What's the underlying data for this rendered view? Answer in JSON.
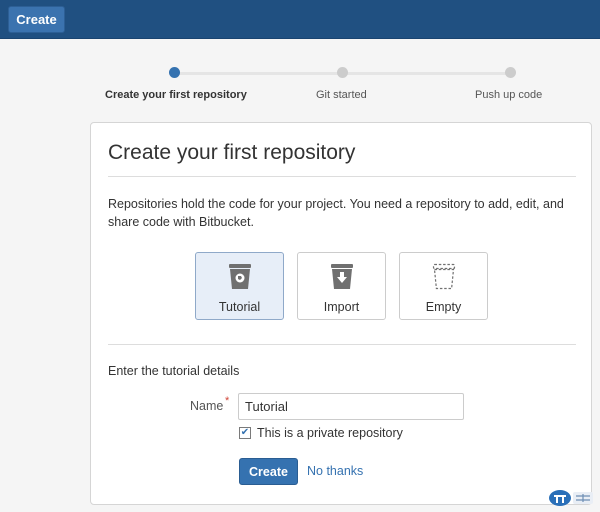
{
  "topbar": {
    "create_label": "Create"
  },
  "progress": {
    "steps": [
      {
        "label": "Create your first repository"
      },
      {
        "label": "Git started"
      },
      {
        "label": "Push up code"
      }
    ]
  },
  "card": {
    "title": "Create your first repository",
    "intro": "Repositories hold the code for your project. You need a repository to add, edit, and share code with Bitbucket.",
    "options": [
      {
        "label": "Tutorial",
        "icon": "bucket-tutorial-icon"
      },
      {
        "label": "Import",
        "icon": "bucket-import-icon"
      },
      {
        "label": "Empty",
        "icon": "bucket-empty-icon"
      }
    ],
    "form": {
      "section_label": "Enter the tutorial details",
      "name_label": "Name",
      "required_mark": "*",
      "name_value": "Tutorial",
      "private_label": "This is a private repository",
      "create_label": "Create",
      "no_thanks_label": "No thanks"
    }
  },
  "colors": {
    "topbar": "#205081",
    "primary": "#3572b0",
    "selected_tile": "#e7eef8"
  }
}
